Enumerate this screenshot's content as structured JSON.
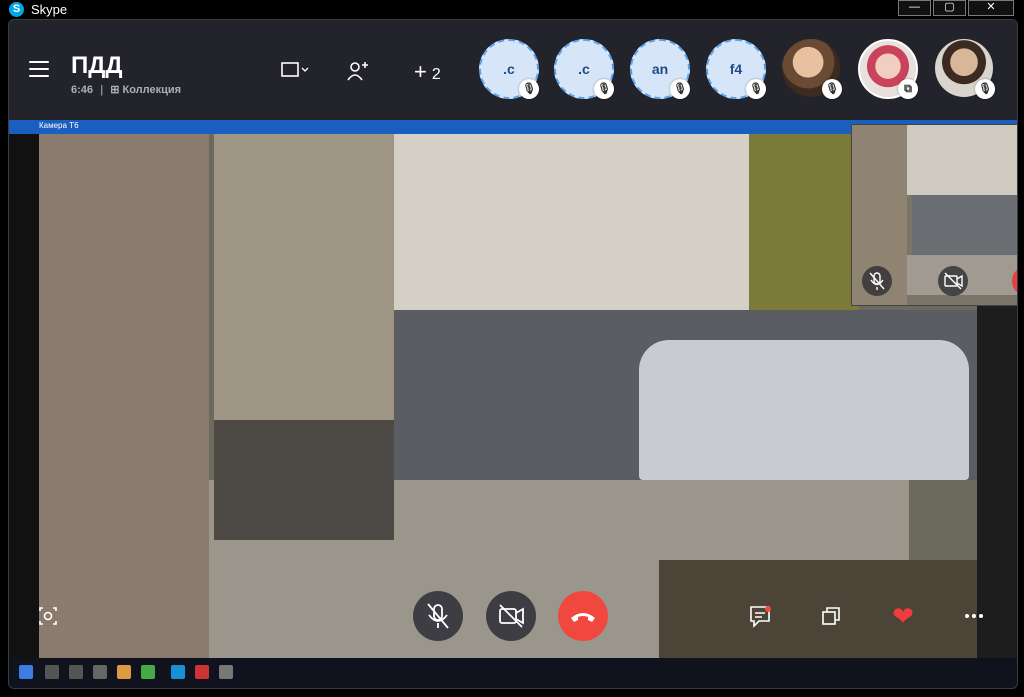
{
  "window": {
    "app_title": "Skype",
    "min": "—",
    "max": "▢",
    "close": "✕"
  },
  "call": {
    "title": "ПДД",
    "duration": "6:46",
    "collection": "Коллекция"
  },
  "header": {
    "more_participants": "2"
  },
  "participants": [
    {
      "initials": ".c",
      "muted": true
    },
    {
      "initials": ".c",
      "muted": true
    },
    {
      "initials": "an",
      "muted": true
    },
    {
      "initials": "f4",
      "muted": true
    },
    {
      "initials": "",
      "muted": true
    },
    {
      "initials": "",
      "muted": false
    },
    {
      "initials": "",
      "muted": true
    }
  ],
  "video": {
    "window_caption": "Камера Т6"
  },
  "colors": {
    "accent": "#1a5fc0",
    "end_call": "#f0483e",
    "heart": "#f03c3c",
    "header_bg": "#23242b"
  },
  "icons": {
    "menu": "hamburger-icon",
    "screen_share": "screen-share-icon",
    "add_person": "add-person-icon",
    "add": "plus-icon",
    "screenshot": "camera-snapshot-icon",
    "mic_off": "mic-off-icon",
    "video_off": "video-off-icon",
    "end_call": "hang-up-icon",
    "chat": "chat-icon",
    "layout": "layout-icon",
    "react": "heart-icon",
    "more": "more-options-icon"
  }
}
